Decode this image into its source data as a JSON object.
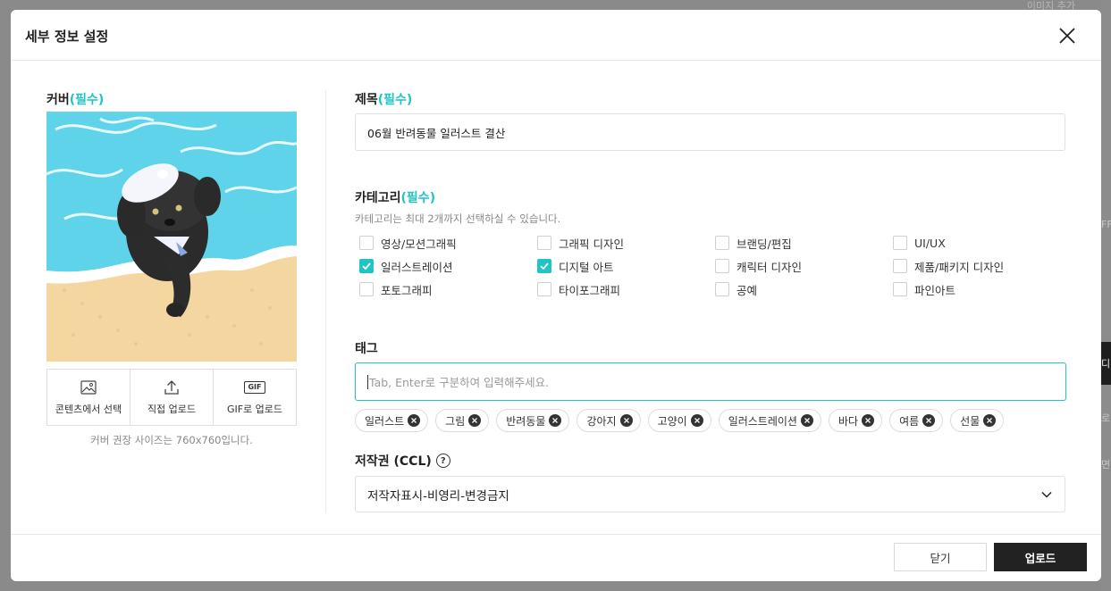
{
  "background": {
    "top_right_text": "이미지 추가",
    "right_edge_texts": [
      "FF",
      "디",
      "로",
      "면"
    ]
  },
  "modal": {
    "title": "세부 정보 설정"
  },
  "cover": {
    "label": "커버",
    "required": "(필수)",
    "actions": [
      {
        "label": "콘텐츠에서 선택",
        "icon": "image-icon"
      },
      {
        "label": "직접 업로드",
        "icon": "upload-icon"
      },
      {
        "label": "GIF로 업로드",
        "icon": "gif-icon",
        "badge": "GIF"
      }
    ],
    "hint": "커버 권장 사이즈는 760x760입니다."
  },
  "title_field": {
    "label": "제목",
    "required": "(필수)",
    "value": "06월 반려동물 일러스트 결산"
  },
  "category": {
    "label": "카테고리",
    "required": "(필수)",
    "hint": "카테고리는 최대 2개까지 선택하실 수 있습니다.",
    "items": [
      {
        "label": "영상/모션그래픽",
        "checked": false
      },
      {
        "label": "그래픽 디자인",
        "checked": false
      },
      {
        "label": "브랜딩/편집",
        "checked": false
      },
      {
        "label": "UI/UX",
        "checked": false
      },
      {
        "label": "일러스트레이션",
        "checked": true
      },
      {
        "label": "디지털 아트",
        "checked": true
      },
      {
        "label": "캐릭터 디자인",
        "checked": false
      },
      {
        "label": "제품/패키지 디자인",
        "checked": false
      },
      {
        "label": "포토그래피",
        "checked": false
      },
      {
        "label": "타이포그래피",
        "checked": false
      },
      {
        "label": "공예",
        "checked": false
      },
      {
        "label": "파인아트",
        "checked": false
      }
    ]
  },
  "tags": {
    "label": "태그",
    "placeholder": "Tab, Enter로 구분하여 입력해주세요.",
    "items": [
      "일러스트",
      "그림",
      "반려동물",
      "강아지",
      "고양이",
      "일러스트레이션",
      "바다",
      "여름",
      "선물"
    ]
  },
  "copyright": {
    "label": "저작권 (CCL)",
    "help": "?",
    "selected": "저작자표시-비영리-변경금지"
  },
  "footer": {
    "close_label": "닫기",
    "upload_label": "업로드"
  },
  "colors": {
    "accent": "#1fc4c4",
    "primary_button": "#222222"
  }
}
